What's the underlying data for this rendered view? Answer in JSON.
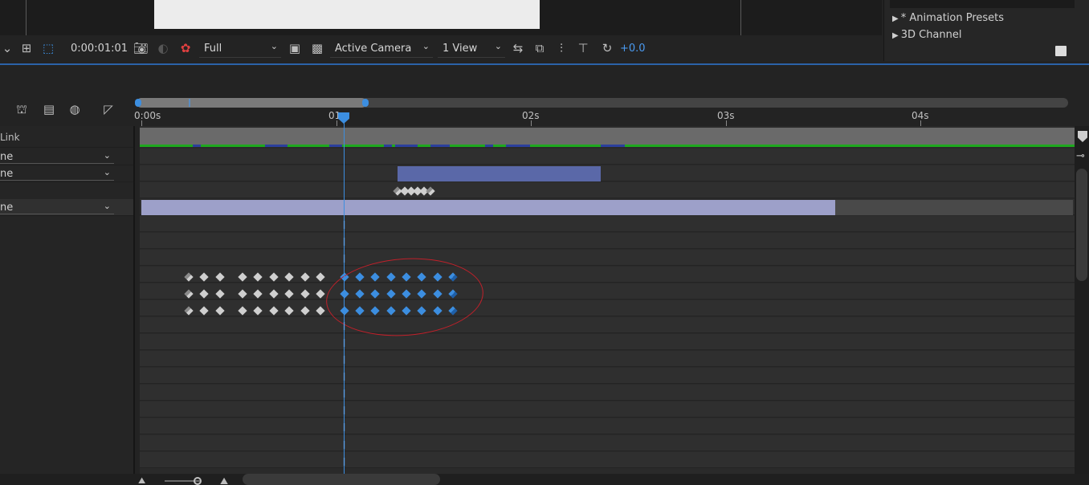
{
  "viewer_toolbar": {
    "timecode": "0:00:01:01",
    "resolution": "Full",
    "camera": "Active Camera",
    "views": "1 View",
    "exposure": "+0.0"
  },
  "effects_panel": {
    "items": [
      {
        "label": "* Animation Presets"
      },
      {
        "label": "3D Channel"
      }
    ]
  },
  "timeline": {
    "ruler_labels": [
      "0:00s",
      "01",
      "02s",
      "03s",
      "04s"
    ],
    "layer_panel": {
      "top_label": "Link",
      "dropdowns": [
        "ne",
        "ne",
        "ne"
      ]
    }
  },
  "colors": {
    "accent_blue": "#3c8ee0",
    "annotation_red": "#c0202a",
    "green_track": "#1ea81e"
  }
}
